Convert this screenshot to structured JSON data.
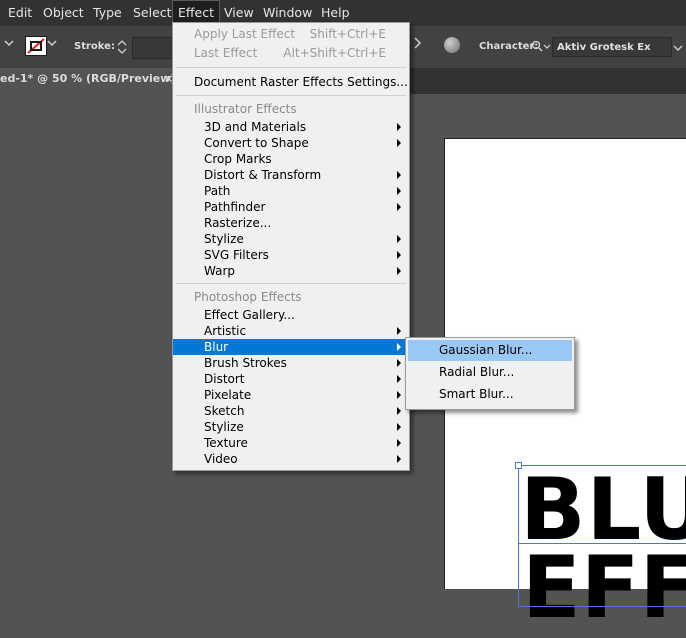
{
  "menubar": {
    "items": [
      {
        "label": "Edit"
      },
      {
        "label": "Object"
      },
      {
        "label": "Type"
      },
      {
        "label": "Select"
      },
      {
        "label": "Effect"
      },
      {
        "label": "View"
      },
      {
        "label": "Window"
      },
      {
        "label": "Help"
      }
    ]
  },
  "controlbar": {
    "stroke_label": "Stroke:",
    "character_label": "Character:",
    "font_name": "Aktiv Grotesk Ex",
    "search_icon": "search-icon"
  },
  "tab": {
    "title": "ed-1* @ 50 % (RGB/Preview)",
    "close": "×"
  },
  "artboard": {
    "line1": "BLU",
    "line2": "EFF"
  },
  "effect_menu": {
    "apply_last": {
      "label": "Apply Last Effect",
      "shortcut": "Shift+Ctrl+E"
    },
    "last_effect": {
      "label": "Last Effect",
      "shortcut": "Alt+Shift+Ctrl+E"
    },
    "raster_settings": "Document Raster Effects Settings...",
    "illustrator_header": "Illustrator Effects",
    "illustrator_items": [
      {
        "label": "3D and Materials",
        "submenu": true
      },
      {
        "label": "Convert to Shape",
        "submenu": true
      },
      {
        "label": "Crop Marks",
        "submenu": false
      },
      {
        "label": "Distort & Transform",
        "submenu": true
      },
      {
        "label": "Path",
        "submenu": true
      },
      {
        "label": "Pathfinder",
        "submenu": true
      },
      {
        "label": "Rasterize...",
        "submenu": false
      },
      {
        "label": "Stylize",
        "submenu": true
      },
      {
        "label": "SVG Filters",
        "submenu": true
      },
      {
        "label": "Warp",
        "submenu": true
      }
    ],
    "photoshop_header": "Photoshop Effects",
    "photoshop_items": [
      {
        "label": "Effect Gallery...",
        "submenu": false
      },
      {
        "label": "Artistic",
        "submenu": true
      },
      {
        "label": "Blur",
        "submenu": true,
        "highlighted": true
      },
      {
        "label": "Brush Strokes",
        "submenu": true
      },
      {
        "label": "Distort",
        "submenu": true
      },
      {
        "label": "Pixelate",
        "submenu": true
      },
      {
        "label": "Sketch",
        "submenu": true
      },
      {
        "label": "Stylize",
        "submenu": true
      },
      {
        "label": "Texture",
        "submenu": true
      },
      {
        "label": "Video",
        "submenu": true
      }
    ]
  },
  "blur_menu": {
    "items": [
      {
        "label": "Gaussian Blur...",
        "highlighted": true
      },
      {
        "label": "Radial Blur..."
      },
      {
        "label": "Smart Blur..."
      }
    ]
  },
  "colors": {
    "menu_highlight": "#0078d7",
    "submenu_highlight": "#99c9f2",
    "app_bg": "#535353"
  }
}
